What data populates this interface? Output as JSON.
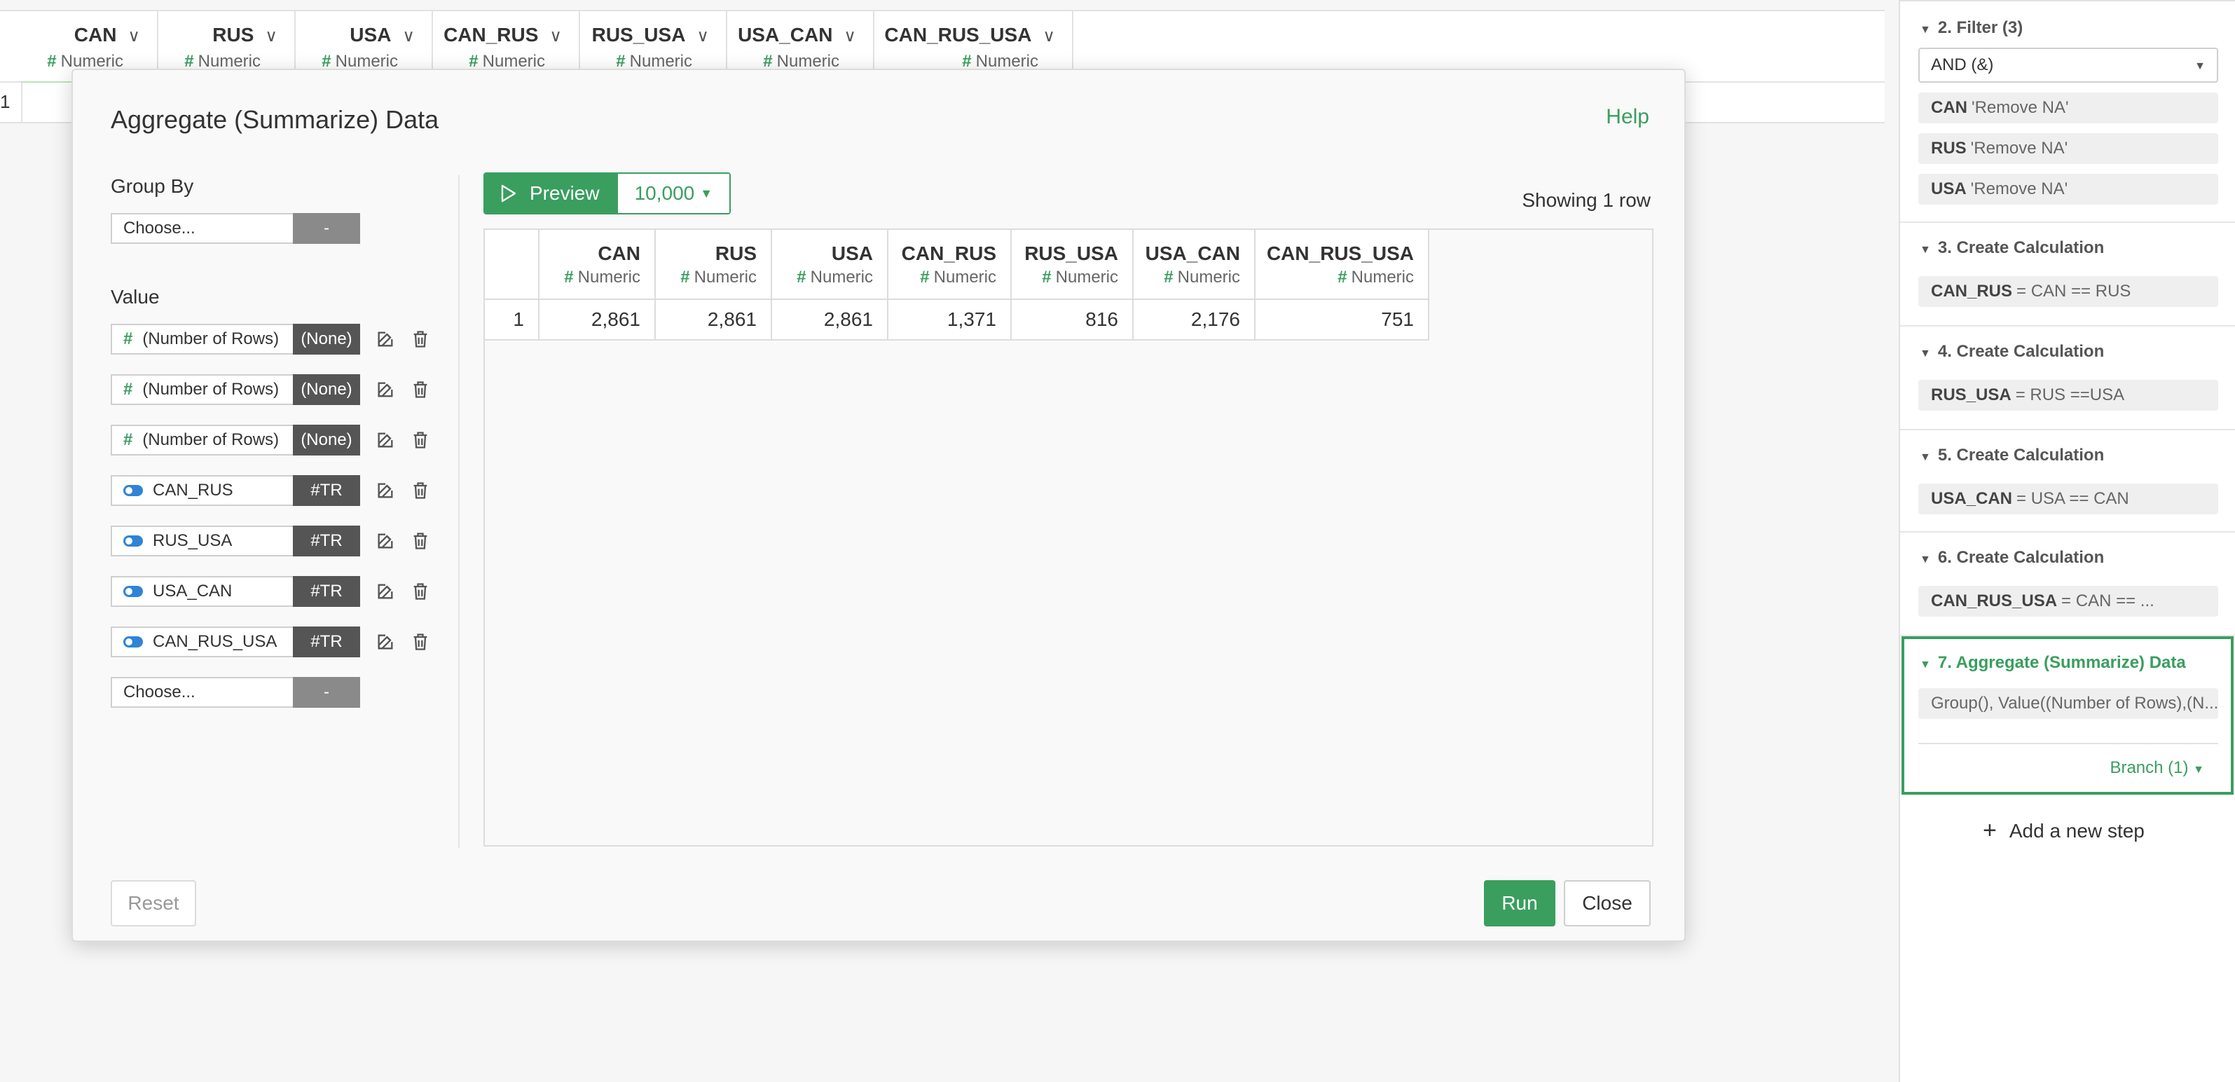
{
  "background_table": {
    "columns": [
      {
        "name": "CAN",
        "type": "Numeric"
      },
      {
        "name": "RUS",
        "type": "Numeric"
      },
      {
        "name": "USA",
        "type": "Numeric"
      },
      {
        "name": "CAN_RUS",
        "type": "Numeric"
      },
      {
        "name": "RUS_USA",
        "type": "Numeric"
      },
      {
        "name": "USA_CAN",
        "type": "Numeric"
      },
      {
        "name": "CAN_RUS_USA",
        "type": "Numeric"
      }
    ],
    "row_number": "1"
  },
  "dialog": {
    "title": "Aggregate (Summarize) Data",
    "help_label": "Help",
    "group_by": {
      "label": "Group By",
      "placeholder": "Choose...",
      "tag": "-"
    },
    "value": {
      "label": "Value",
      "rows": [
        {
          "name": "(Number of Rows)",
          "tag": "(None)",
          "kind": "numeric"
        },
        {
          "name": "(Number of Rows)",
          "tag": "(None)",
          "kind": "numeric"
        },
        {
          "name": "(Number of Rows)",
          "tag": "(None)",
          "kind": "numeric"
        },
        {
          "name": "CAN_RUS",
          "tag": "#TR",
          "kind": "logical"
        },
        {
          "name": "RUS_USA",
          "tag": "#TR",
          "kind": "logical"
        },
        {
          "name": "USA_CAN",
          "tag": "#TR",
          "kind": "logical"
        },
        {
          "name": "CAN_RUS_USA",
          "tag": "#TR",
          "kind": "logical"
        }
      ],
      "empty_row": {
        "placeholder": "Choose...",
        "tag": "-"
      }
    },
    "preview": {
      "button_label": "Preview",
      "row_limit": "10,000",
      "showing": "Showing 1 row",
      "columns": [
        {
          "name": "CAN",
          "type": "Numeric"
        },
        {
          "name": "RUS",
          "type": "Numeric"
        },
        {
          "name": "USA",
          "type": "Numeric"
        },
        {
          "name": "CAN_RUS",
          "type": "Numeric"
        },
        {
          "name": "RUS_USA",
          "type": "Numeric"
        },
        {
          "name": "USA_CAN",
          "type": "Numeric"
        },
        {
          "name": "CAN_RUS_USA",
          "type": "Numeric"
        }
      ],
      "rows": [
        {
          "num": "1",
          "values": [
            "2,861",
            "2,861",
            "2,861",
            "1,371",
            "816",
            "2,176",
            "751"
          ]
        }
      ]
    },
    "reset_label": "Reset",
    "run_label": "Run",
    "close_label": "Close"
  },
  "steps": {
    "filter": {
      "title": "2. Filter (3)",
      "select_value": "AND (&)",
      "conditions": [
        {
          "col": "CAN",
          "cond": "'Remove NA'"
        },
        {
          "col": "RUS",
          "cond": "'Remove NA'"
        },
        {
          "col": "USA",
          "cond": "'Remove NA'"
        }
      ]
    },
    "calc3": {
      "title": "3. Create Calculation",
      "col": "CAN_RUS",
      "expr": "= CAN == RUS"
    },
    "calc4": {
      "title": "4. Create Calculation",
      "col": "RUS_USA",
      "expr": "= RUS ==USA"
    },
    "calc5": {
      "title": "5. Create Calculation",
      "col": "USA_CAN",
      "expr": "= USA == CAN"
    },
    "calc6": {
      "title": "6. Create Calculation",
      "col": "CAN_RUS_USA",
      "expr": "= CAN == ..."
    },
    "agg7": {
      "title": "7. Aggregate (Summarize) Data",
      "summary": "Group(), Value((Number of Rows),(N...",
      "branch": "Branch (1)"
    },
    "add_step_label": "Add a new step"
  },
  "colors": {
    "accent": "#3a9e5f",
    "toggle": "#2f84d6",
    "tag_dark": "#555555"
  }
}
